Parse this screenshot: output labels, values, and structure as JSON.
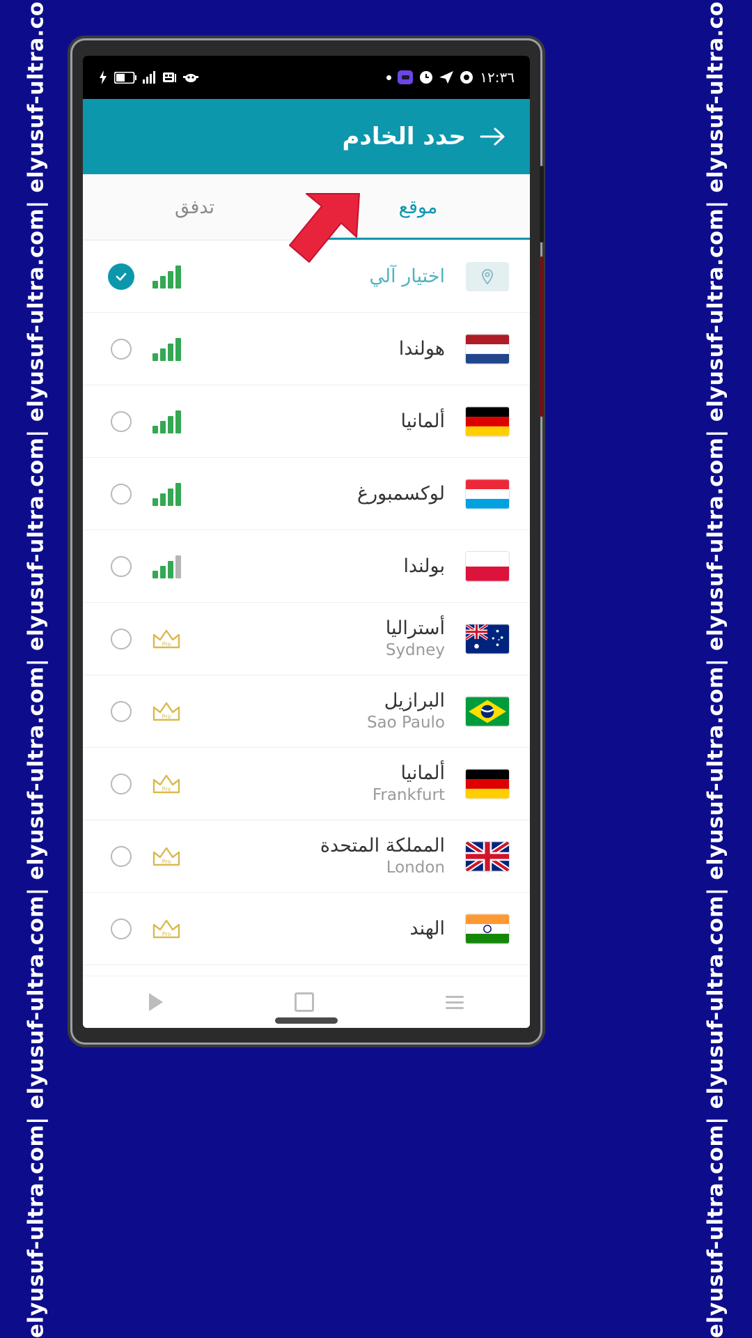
{
  "watermark": {
    "text": "elyusuf-ultra.com| elyusuf-ultra.com| elyusuf-ultra.com| elyusuf-ultra.com| elyusuf-ultra.com| elyusuf-ultra.com|",
    "color": "#ffffff",
    "background": "#0d0d8c"
  },
  "statusbar": {
    "time": "١٢:٣٦",
    "left_icons": [
      "usb-charging-icon",
      "battery-icon",
      "signal-bars-icon",
      "sim-card-icon",
      "mask-icon"
    ],
    "right_icons": [
      "dot-icon",
      "purple-app-icon",
      "clock-icon",
      "send-icon",
      "circle-badge-icon"
    ]
  },
  "appbar": {
    "title": "حدد الخادم",
    "back_icon": "back-arrow-icon",
    "background": "#0d97ad"
  },
  "tabs": {
    "accent": "#0d97ad",
    "items": [
      {
        "label": "موقع",
        "active": true
      },
      {
        "label": "تدفق",
        "active": false
      }
    ]
  },
  "annotation": {
    "arrow_color": "#e8243c",
    "points_to": "موقع"
  },
  "servers": [
    {
      "name_ar": "اختيار آلي",
      "city": "",
      "icon": "location-pin-icon",
      "flag": "auto",
      "quality": "signal",
      "bars_on": 4,
      "selected": true,
      "pro": false
    },
    {
      "name_ar": "هولندا",
      "city": "",
      "icon": "flag-netherlands",
      "flag": "nl",
      "quality": "signal",
      "bars_on": 4,
      "selected": false,
      "pro": false
    },
    {
      "name_ar": "ألمانيا",
      "city": "",
      "icon": "flag-germany",
      "flag": "de",
      "quality": "signal",
      "bars_on": 4,
      "selected": false,
      "pro": false
    },
    {
      "name_ar": "لوكسمبورغ",
      "city": "",
      "icon": "flag-luxembourg",
      "flag": "lu",
      "quality": "signal",
      "bars_on": 4,
      "selected": false,
      "pro": false
    },
    {
      "name_ar": "بولندا",
      "city": "",
      "icon": "flag-poland",
      "flag": "pl",
      "quality": "signal",
      "bars_on": 3,
      "selected": false,
      "pro": false
    },
    {
      "name_ar": "أستراليا",
      "city": "Sydney",
      "icon": "flag-australia",
      "flag": "au",
      "quality": "pro",
      "bars_on": 0,
      "selected": false,
      "pro": true
    },
    {
      "name_ar": "البرازيل",
      "city": "Sao Paulo",
      "icon": "flag-brazil",
      "flag": "br",
      "quality": "pro",
      "bars_on": 0,
      "selected": false,
      "pro": true
    },
    {
      "name_ar": "ألمانيا",
      "city": "Frankfurt",
      "icon": "flag-germany",
      "flag": "de",
      "quality": "pro",
      "bars_on": 0,
      "selected": false,
      "pro": true
    },
    {
      "name_ar": "المملكة المتحدة",
      "city": "London",
      "icon": "flag-united-kingdom",
      "flag": "gb",
      "quality": "pro",
      "bars_on": 0,
      "selected": false,
      "pro": true
    },
    {
      "name_ar": "الهند",
      "city": "",
      "icon": "flag-india",
      "flag": "in",
      "quality": "pro",
      "bars_on": 0,
      "selected": false,
      "pro": true
    }
  ],
  "pro_badge_label": "Pro",
  "navbar": {
    "items": [
      {
        "icon": "back-triangle-icon",
        "name": "nav-back"
      },
      {
        "icon": "home-square-icon",
        "name": "nav-home"
      },
      {
        "icon": "recents-lines-icon",
        "name": "nav-recents"
      }
    ]
  }
}
